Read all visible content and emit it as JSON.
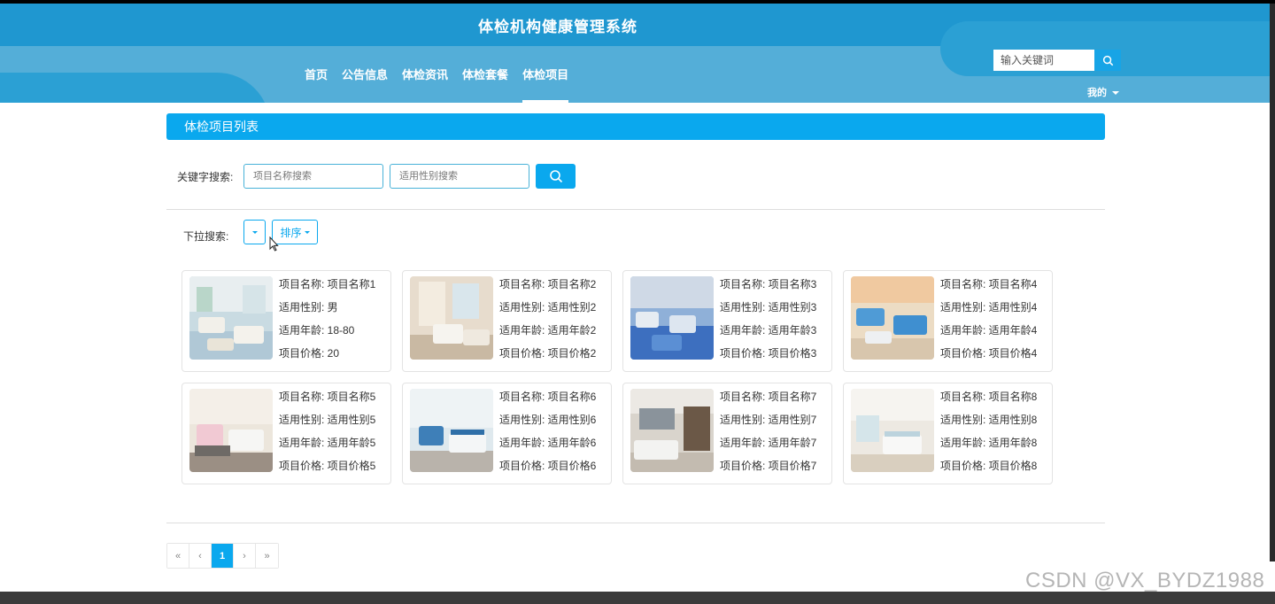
{
  "site": {
    "title": "体检机构健康管理系统"
  },
  "nav": [
    {
      "label": "首页"
    },
    {
      "label": "公告信息"
    },
    {
      "label": "体检资讯"
    },
    {
      "label": "体检套餐"
    },
    {
      "label": "体检项目",
      "active": true
    }
  ],
  "header_search": {
    "placeholder": "输入关键词"
  },
  "user_menu": {
    "label": "我的"
  },
  "panel": {
    "title": "体检项目列表"
  },
  "keyword_search": {
    "label": "关键字搜索:",
    "name_placeholder": "项目名称搜索",
    "sex_placeholder": "适用性别搜索"
  },
  "dropdown_search": {
    "label": "下拉搜索:",
    "sort_label": "排序"
  },
  "items": [
    {
      "name": "项目名称: 项目名称1",
      "sex": "适用性别: 男",
      "age": "适用年龄: 18-80",
      "price": "项目价格: 20"
    },
    {
      "name": "项目名称: 项目名称2",
      "sex": "适用性别: 适用性别2",
      "age": "适用年龄: 适用年龄2",
      "price": "项目价格: 项目价格2"
    },
    {
      "name": "项目名称: 项目名称3",
      "sex": "适用性别: 适用性别3",
      "age": "适用年龄: 适用年龄3",
      "price": "项目价格: 项目价格3"
    },
    {
      "name": "项目名称: 项目名称4",
      "sex": "适用性别: 适用性别4",
      "age": "适用年龄: 适用年龄4",
      "price": "项目价格: 项目价格4"
    },
    {
      "name": "项目名称: 项目名称5",
      "sex": "适用性别: 适用性别5",
      "age": "适用年龄: 适用年龄5",
      "price": "项目价格: 项目价格5"
    },
    {
      "name": "项目名称: 项目名称6",
      "sex": "适用性别: 适用性别6",
      "age": "适用年龄: 适用年龄6",
      "price": "项目价格: 项目价格6"
    },
    {
      "name": "项目名称: 项目名称7",
      "sex": "适用性别: 适用性别7",
      "age": "适用年龄: 适用年龄7",
      "price": "项目价格: 项目价格7"
    },
    {
      "name": "项目名称: 项目名称8",
      "sex": "适用性别: 适用性别8",
      "age": "适用年龄: 适用年龄8",
      "price": "项目价格: 项目价格8"
    }
  ],
  "pagination": {
    "first": "«",
    "prev": "‹",
    "current": "1",
    "next": "›",
    "last": "»"
  },
  "watermark": "CSDN @VX_BYDZ1988",
  "colors": {
    "header": "#1f97d0",
    "accent": "#0aa8ee"
  }
}
